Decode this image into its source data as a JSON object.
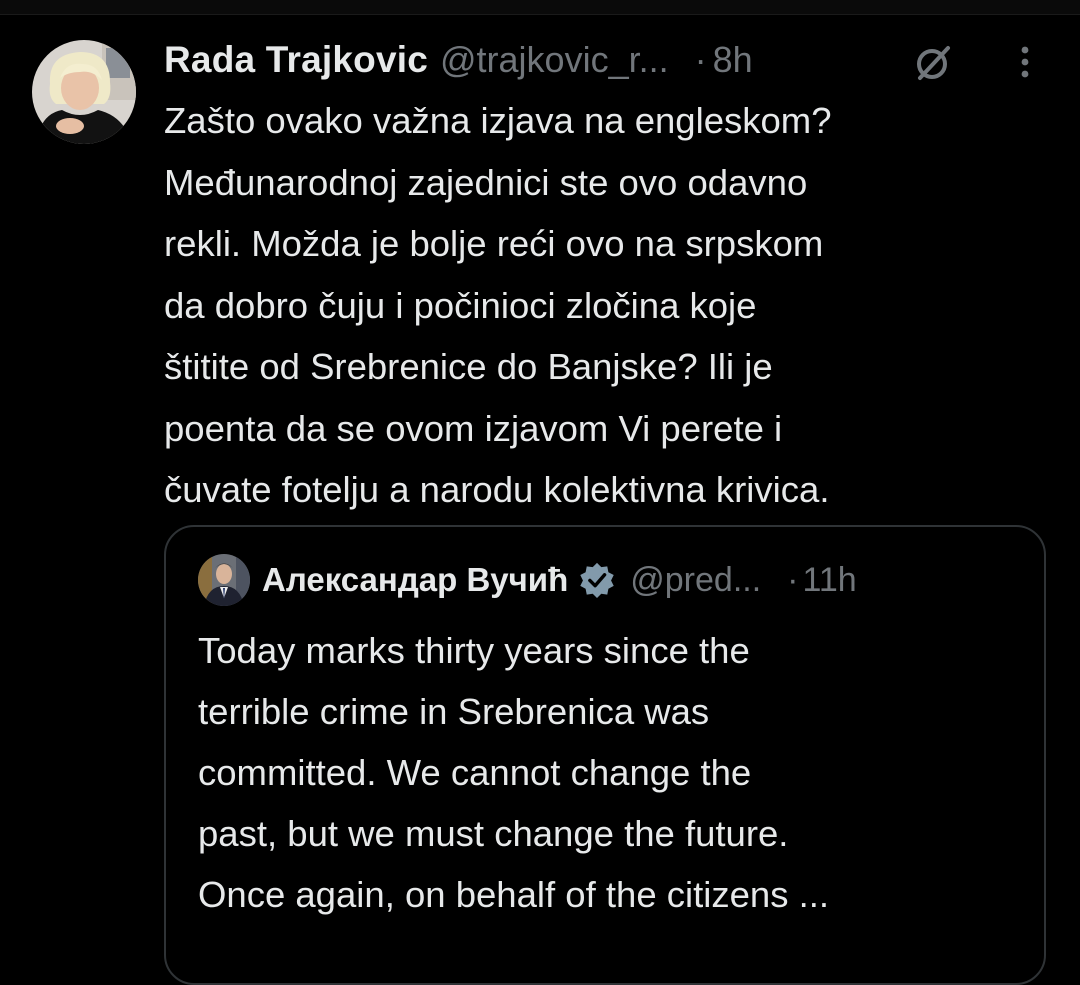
{
  "post": {
    "author_name": "Rada Trajkovic",
    "handle": "@trajkovic_r...",
    "separator": "·",
    "time": "8h",
    "grok_icon": "grok-icon",
    "more_icon": "more-vertical-icon",
    "body_lines": [
      "Zašto ovako važna izjava na engleskom?",
      "Međunarodnoj zajednici ste ovo odavno",
      "rekli. Možda je bolje reći ovo na srpskom",
      "da dobro čuju i počinioci zločina koje",
      "štitite od Srebrenice do Banjske? Ili je",
      "poenta da se ovom izjavom Vi perete i",
      "čuvate fotelju a narodu kolektivna krivica."
    ]
  },
  "quoted_post": {
    "author_name": "Александар Вучић",
    "verified_icon": "verified-badge-icon",
    "handle": "@pred...",
    "separator": "·",
    "time": "11h",
    "body_lines": [
      "Today marks thirty years since the",
      "terrible crime in Srebrenica was",
      "committed. We cannot change the",
      "past, but we must change the future.",
      "Once again, on behalf of the citizens ..."
    ]
  },
  "colors": {
    "background": "#000000",
    "text_primary": "#e7e9ea",
    "text_secondary": "#71767b",
    "border": "#2f3336",
    "verified_badge": "#829aab"
  }
}
